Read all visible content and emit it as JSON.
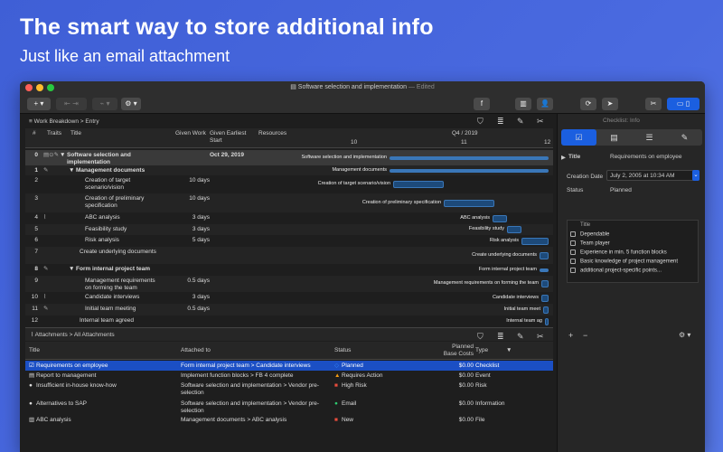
{
  "promo": {
    "headline": "The smart way to store additional info",
    "subline": "Just like an email attachment"
  },
  "window": {
    "title": "Software selection and implementation",
    "edited": "— Edited",
    "traffic_colors": [
      "#fe5f57",
      "#febc2e",
      "#28c840"
    ]
  },
  "toolbar": {
    "add": "+ ▾",
    "settings": "⚙ ▾",
    "f_btn": "f",
    "library": "▥",
    "person": "👤",
    "refresh": "⟳",
    "share": "➤",
    "tools": "✂"
  },
  "path": {
    "root": "Work Breakdown",
    "sep": ">",
    "leaf": "Entry"
  },
  "gantt": {
    "headers": {
      "num": "#",
      "traits": "Traits",
      "title": "Title",
      "work": "Given Work",
      "start": "Given Earliest Start",
      "resources": "Resources",
      "quarter": "Q4 / 2019",
      "w10": "10",
      "w11": "11",
      "w12": "12"
    },
    "rows": [
      {
        "num": "0",
        "title": "Software selection and implementation",
        "work": "",
        "start": "Oct 29, 2019",
        "label": "Software selection and implementation"
      },
      {
        "num": "1",
        "title": "Management documents",
        "work": "",
        "start": "",
        "label": "Management documents"
      },
      {
        "num": "2",
        "title": "Creation of target scenario/vision",
        "work": "10 days",
        "start": "",
        "label": "Creation of target scenario/vision"
      },
      {
        "num": "3",
        "title": "Creation of preliminary specification",
        "work": "10 days",
        "start": "",
        "label": "Creation of preliminary specification"
      },
      {
        "num": "4",
        "title": "ABC analysis",
        "work": "3 days",
        "start": "",
        "label": "ABC analysis"
      },
      {
        "num": "5",
        "title": "Feasibility study",
        "work": "3 days",
        "start": "",
        "label": "Feasibility study"
      },
      {
        "num": "6",
        "title": "Risk analysis",
        "work": "5 days",
        "start": "",
        "label": "Risk analysis"
      },
      {
        "num": "7",
        "title": "Create underlying documents",
        "work": "",
        "start": "",
        "label": "Create underlying documents"
      },
      {
        "num": "8",
        "title": "Form internal project team",
        "work": "",
        "start": "",
        "label": "Form internal project team"
      },
      {
        "num": "9",
        "title": "Management requirements on forming the team",
        "work": "0.5 days",
        "start": "",
        "label": "Management requirements on forming the team"
      },
      {
        "num": "10",
        "title": "Candidate interviews",
        "work": "3 days",
        "start": "",
        "label": "Candidate interviews"
      },
      {
        "num": "11",
        "title": "Initial team meeting",
        "work": "0.5 days",
        "start": "",
        "label": "Initial team meet"
      },
      {
        "num": "12",
        "title": "Internal team agreed",
        "work": "",
        "start": "",
        "label": "Internal team ag"
      }
    ]
  },
  "attachments": {
    "path_root": "Attachments",
    "path_leaf": "All Attachments",
    "headers": {
      "title": "Title",
      "attached": "Attached to",
      "status": "Status",
      "cost": "Planned Base Costs",
      "type": "Type"
    },
    "rows": [
      {
        "title": "Requirements on employee",
        "attached": "Form internal project team  > Candidate interviews",
        "status": "Planned",
        "cost": "$0.00",
        "type": "Checklist"
      },
      {
        "title": "Report to management",
        "attached": "Implement function blocks > FB 4 complete",
        "status": "Requires Action",
        "cost": "$0.00",
        "type": "Event"
      },
      {
        "title": "Insufficient in-house know-how",
        "attached": "Software selection and implementation > Vendor pre-selection",
        "status": "High Risk",
        "cost": "$0.00",
        "type": "Risk"
      },
      {
        "title": "Alternatives to SAP",
        "attached": "Software selection and implementation > Vendor pre-selection",
        "status": "Email",
        "cost": "$0.00",
        "type": "Information"
      },
      {
        "title": "ABC analysis",
        "attached": "Management documents > ABC analysis",
        "status": "New",
        "cost": "$0.00",
        "type": "File"
      }
    ],
    "status_colors": [
      "#3a8cff",
      "#f39c12",
      "#e74c3c",
      "#2ecc71",
      "#e74c3c"
    ]
  },
  "inspector": {
    "header": "Checklist: Info",
    "title_label": "Title",
    "title_value": "Requirements on employee",
    "creation_label": "Creation Date",
    "creation_value": "July 2, 2005 at 10:34 AM",
    "status_label": "Status",
    "status_value": "Planned",
    "list_header": "Title",
    "items": [
      "Dependable",
      "Team player",
      "Experience in min. 5 function blocks",
      "Basic knowledge of project management",
      "additional project-specific points..."
    ],
    "add": "+",
    "remove": "−",
    "gear": "⚙ ▾"
  }
}
